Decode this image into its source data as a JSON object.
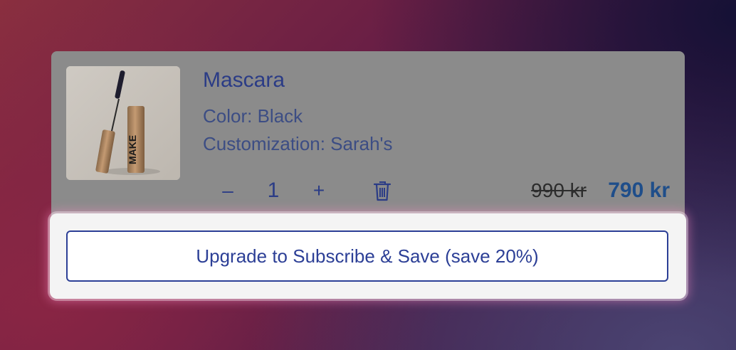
{
  "cart_item": {
    "title": "Mascara",
    "attributes": {
      "color": "Color: Black",
      "customization": "Customization: Sarah's"
    },
    "product_image": {
      "alt": "Mascara tube",
      "tube_label": "MAKE"
    },
    "quantity": {
      "decrement_label": "–",
      "value": "1",
      "increment_label": "+"
    },
    "remove_icon": "trash-icon",
    "price": {
      "original": "990 kr",
      "current": "790 kr"
    }
  },
  "upsell": {
    "button_label": "Upgrade to Subscribe & Save (save 20%)"
  },
  "colors": {
    "accent": "#2c3f96",
    "price": "#1f4e8a"
  }
}
